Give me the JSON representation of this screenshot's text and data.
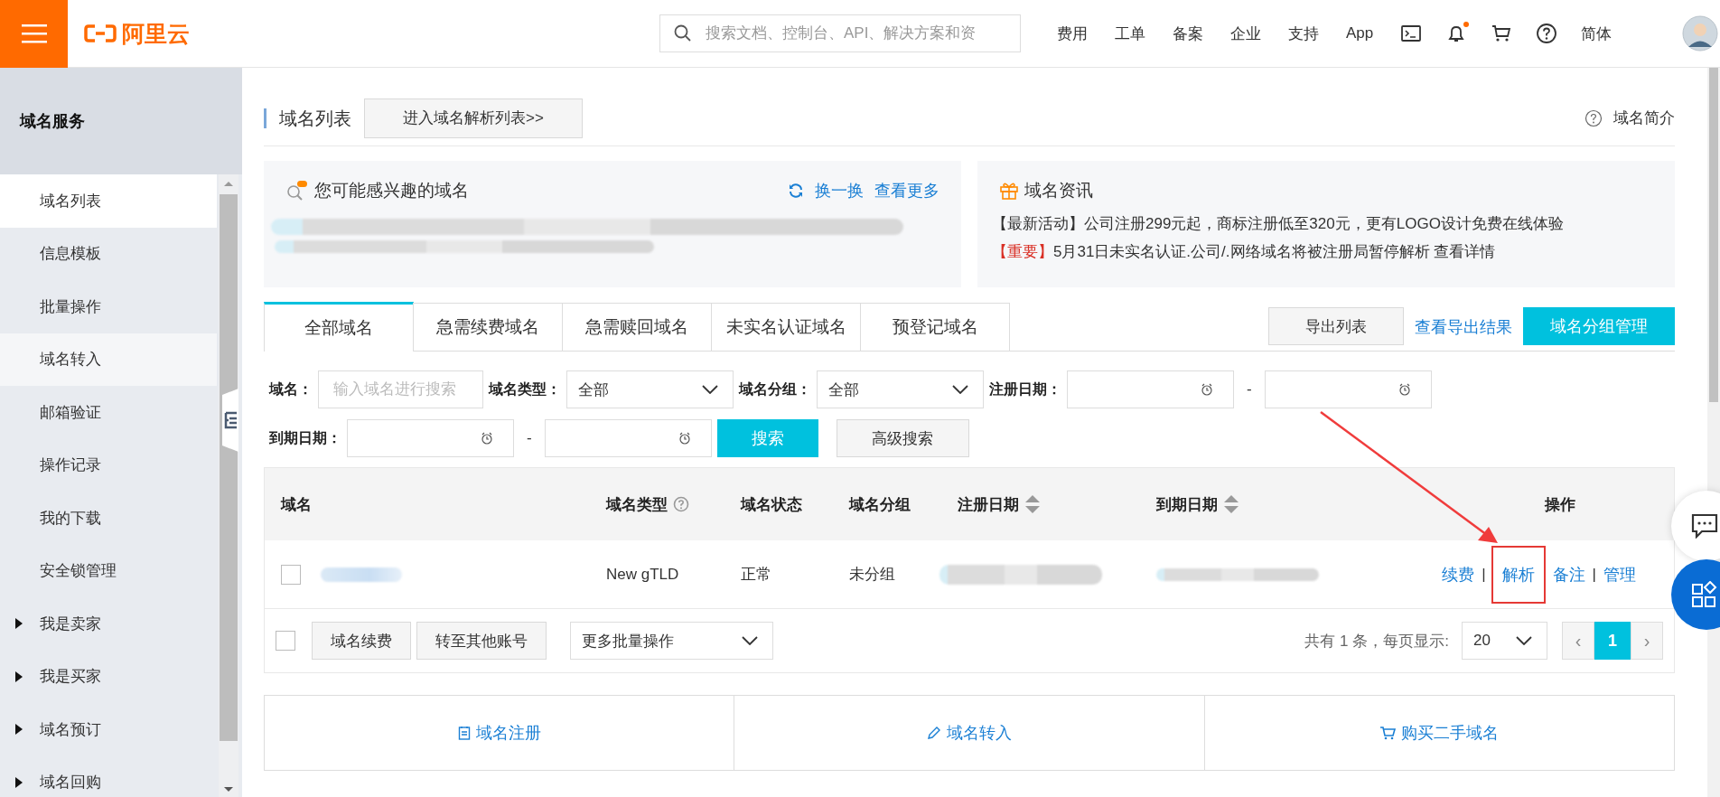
{
  "header": {
    "brand": "阿里云",
    "search": {
      "placeholder": "搜索文档、控制台、API、解决方案和资"
    },
    "nav": [
      "费用",
      "工单",
      "备案",
      "企业",
      "支持",
      "App"
    ],
    "icons": [
      {
        "kind": "terminal",
        "badge": false
      },
      {
        "kind": "bell",
        "badge": true
      },
      {
        "kind": "cart",
        "badge": false
      },
      {
        "kind": "help",
        "badge": false
      }
    ],
    "language": "简体"
  },
  "sidebar": {
    "title": "域名服务",
    "items": [
      {
        "label": "域名列表",
        "kind": "link",
        "selected": true
      },
      {
        "label": "信息模板",
        "kind": "link",
        "selected": false
      },
      {
        "label": "批量操作",
        "kind": "link",
        "selected": false
      },
      {
        "label": "域名转入",
        "kind": "link",
        "selected": false,
        "hovered": true
      },
      {
        "label": "邮箱验证",
        "kind": "link",
        "selected": false
      },
      {
        "label": "操作记录",
        "kind": "link",
        "selected": false
      },
      {
        "label": "我的下载",
        "kind": "link",
        "selected": false
      },
      {
        "label": "安全锁管理",
        "kind": "link",
        "selected": false
      },
      {
        "label": "我是卖家",
        "kind": "group",
        "selected": false
      },
      {
        "label": "我是买家",
        "kind": "group",
        "selected": false
      },
      {
        "label": "域名预订",
        "kind": "group",
        "selected": false
      },
      {
        "label": "域名回购",
        "kind": "group",
        "selected": false
      }
    ]
  },
  "page": {
    "title": "域名列表",
    "dns_button": "进入域名解析列表>>",
    "help_link": "域名简介"
  },
  "suggest": {
    "title": "您可能感兴趣的域名",
    "refresh": "换一换",
    "more": "查看更多"
  },
  "news": {
    "title": "域名资讯",
    "items": [
      {
        "tag": "【最新活动】",
        "color": "#333333",
        "text": "公司注册299元起，商标注册低至320元，更有LOGO设计免费在线体验"
      },
      {
        "tag": "【重要】",
        "color": "#d93026",
        "text": "5月31日未实名认证.公司/.网络域名将被注册局暂停解析 查看详情"
      }
    ]
  },
  "tabs": [
    {
      "label": "全部域名",
      "selected": true
    },
    {
      "label": "急需续费域名",
      "selected": false
    },
    {
      "label": "急需赎回域名",
      "selected": false
    },
    {
      "label": "未实名认证域名",
      "selected": false
    },
    {
      "label": "预登记域名",
      "selected": false
    }
  ],
  "toolbar": {
    "export": "导出列表",
    "export_results": "查看导出结果",
    "group_manage": "域名分组管理"
  },
  "filters": {
    "name": {
      "label": "域名：",
      "placeholder": "输入域名进行搜索"
    },
    "type": {
      "label": "域名类型：",
      "value": "全部"
    },
    "group": {
      "label": "域名分组：",
      "value": "全部"
    },
    "reg_date": {
      "label": "注册日期：",
      "separator": "-"
    },
    "exp_date": {
      "label": "到期日期：",
      "separator": "-"
    },
    "search": "搜索",
    "advanced": "高级搜索"
  },
  "table": {
    "columns": [
      {
        "label": "域名",
        "kind": "plain"
      },
      {
        "label": "域名类型",
        "kind": "help"
      },
      {
        "label": "域名状态",
        "kind": "plain"
      },
      {
        "label": "域名分组",
        "kind": "plain"
      },
      {
        "label": "注册日期",
        "kind": "sort"
      },
      {
        "label": "到期日期",
        "kind": "sort"
      },
      {
        "label": "操作",
        "kind": "center"
      }
    ],
    "rows": [
      {
        "checked": false,
        "type": "New gTLD",
        "status": "正常",
        "group": "未分组",
        "actions": [
          {
            "label": "续费",
            "highlighted": false,
            "separator": "|"
          },
          {
            "label": "解析",
            "highlighted": true
          },
          {
            "label": "备注",
            "highlighted": false,
            "separator": "|"
          },
          {
            "label": "管理",
            "highlighted": false
          }
        ]
      }
    ]
  },
  "footer": {
    "checked": false,
    "bulk_buttons": [
      "域名续费",
      "转至其他账号"
    ],
    "more_select": "更多批量操作",
    "total": "共有 1 条，每页显示:",
    "page_size": "20",
    "pager": [
      {
        "label": "‹",
        "kind": "prev",
        "selected": false,
        "disabled": true
      },
      {
        "label": "1",
        "kind": "page",
        "selected": true,
        "disabled": false
      },
      {
        "label": "›",
        "kind": "next",
        "selected": false,
        "disabled": true
      }
    ]
  },
  "quick_links": [
    {
      "label": "域名注册",
      "kind": "register"
    },
    {
      "label": "域名转入",
      "kind": "transfer"
    },
    {
      "label": "购买二手域名",
      "kind": "cart"
    }
  ]
}
